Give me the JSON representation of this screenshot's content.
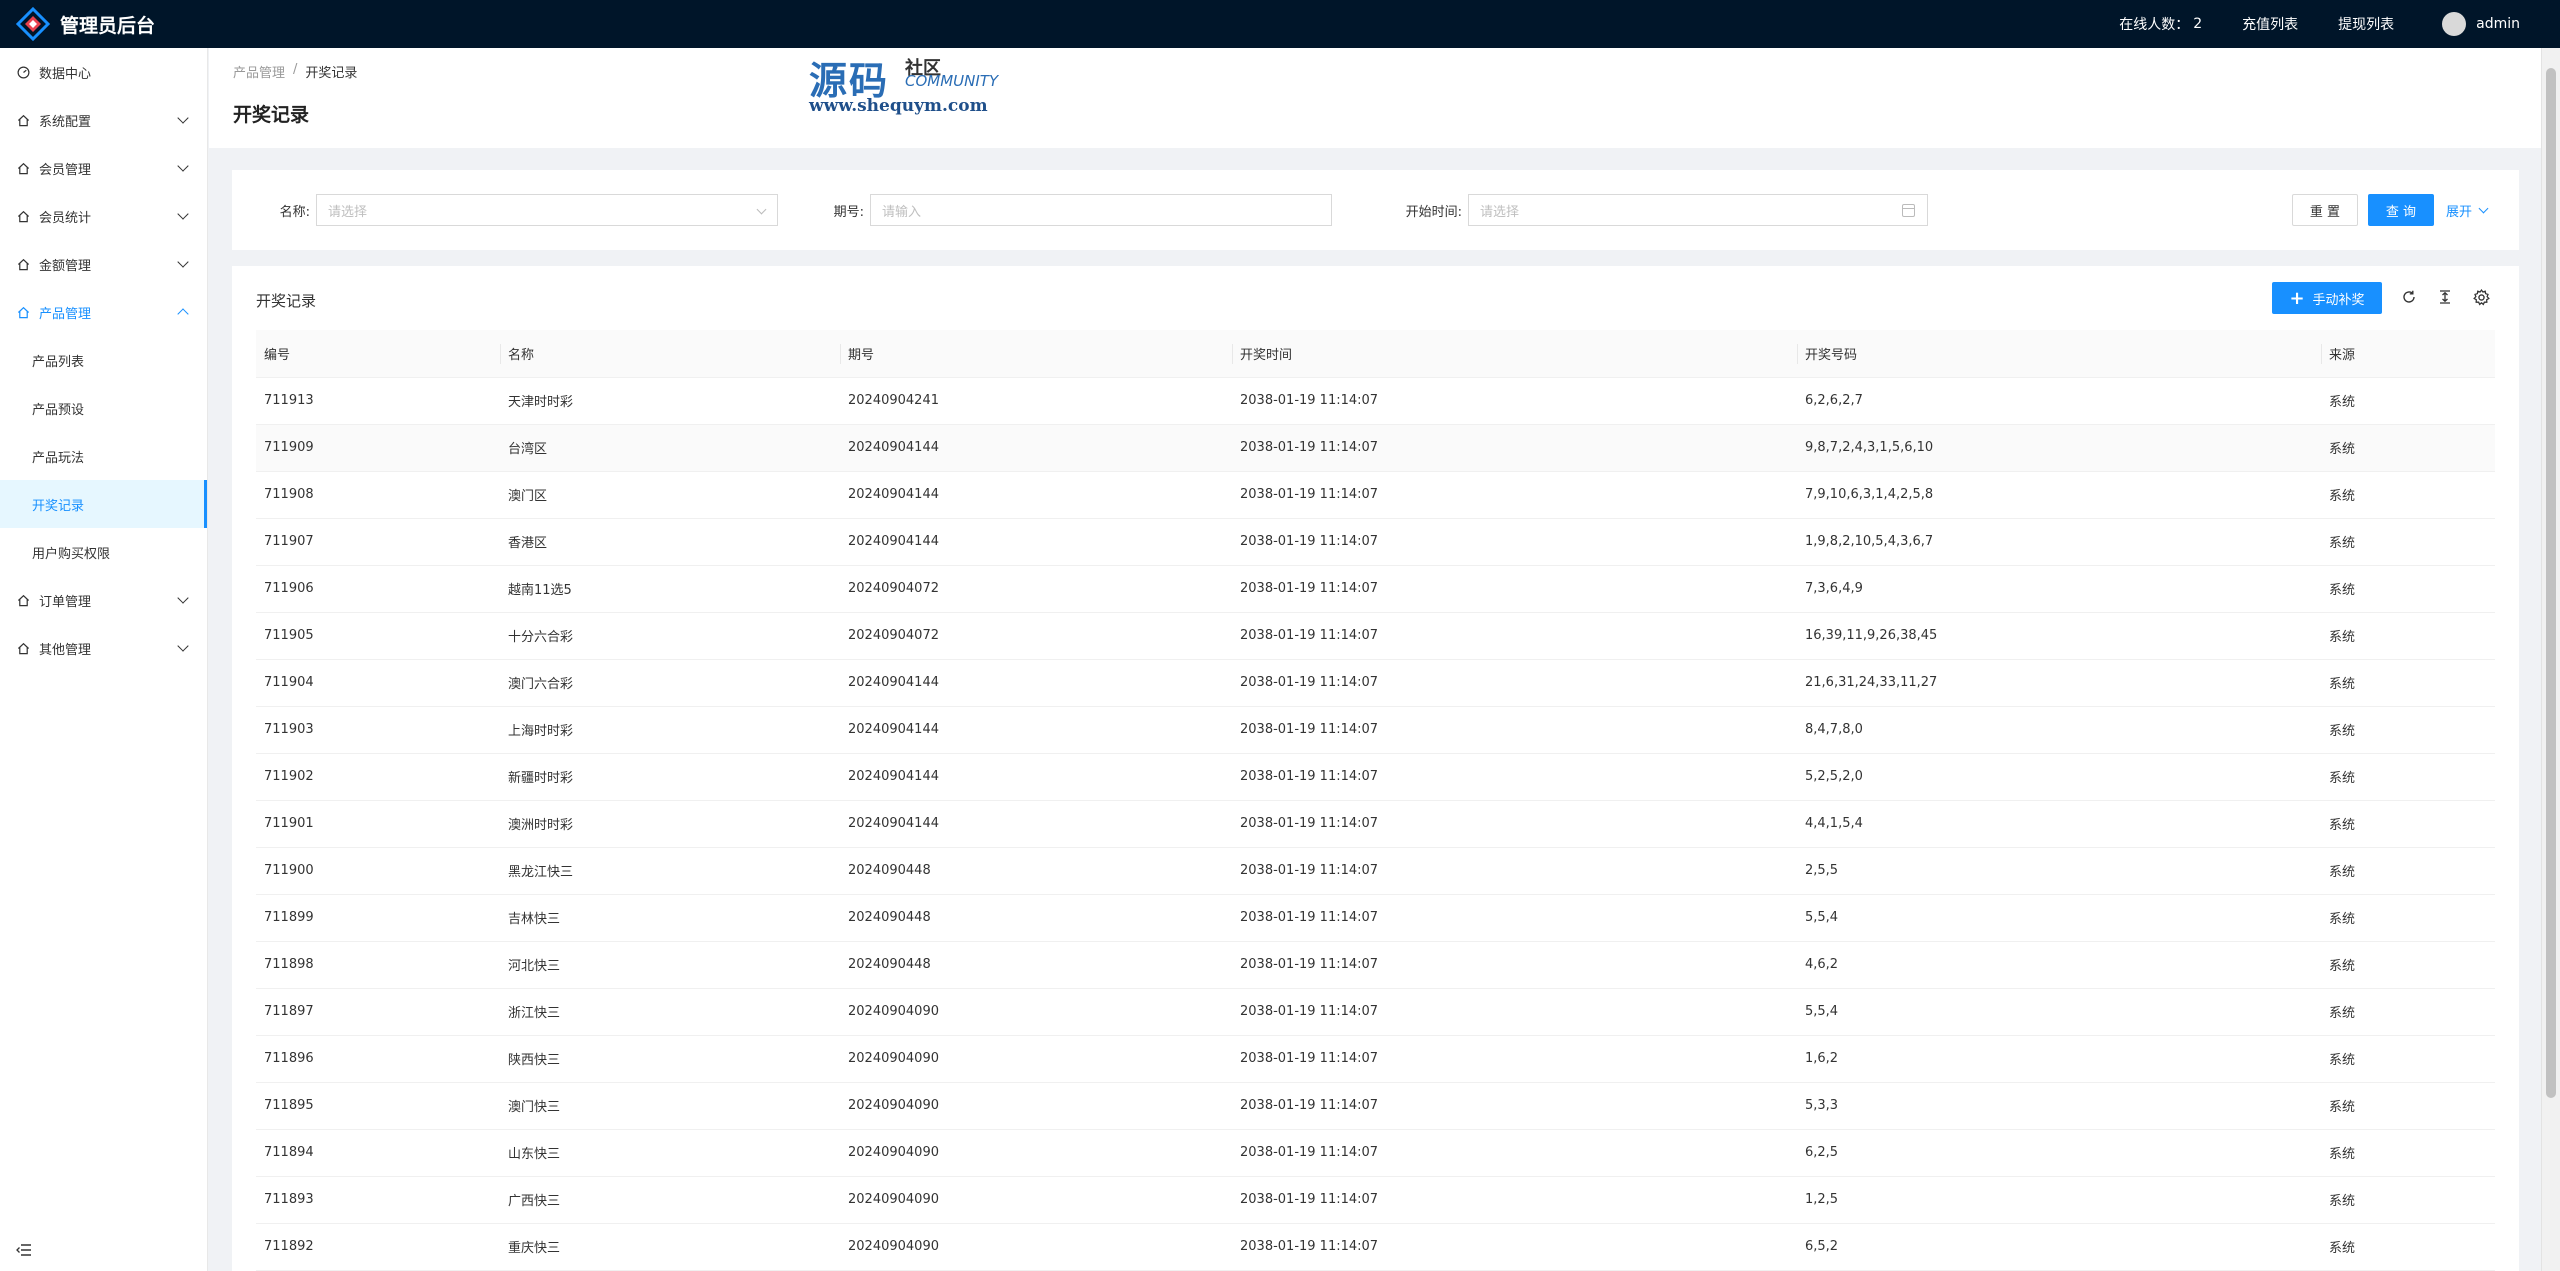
{
  "header": {
    "app_title": "管理员后台",
    "online_label": "在线人数：",
    "online_count": "2",
    "recharge_link": "充值列表",
    "withdraw_link": "提现列表",
    "username": "admin"
  },
  "sidebar": {
    "items": [
      {
        "label": "数据中心",
        "expandable": false
      },
      {
        "label": "系统配置",
        "expandable": true
      },
      {
        "label": "会员管理",
        "expandable": true
      },
      {
        "label": "会员统计",
        "expandable": true
      },
      {
        "label": "金额管理",
        "expandable": true
      },
      {
        "label": "产品管理",
        "expandable": true,
        "open": true
      },
      {
        "label": "订单管理",
        "expandable": true
      },
      {
        "label": "其他管理",
        "expandable": true
      }
    ],
    "submenu": [
      "产品列表",
      "产品预设",
      "产品玩法",
      "开奖记录",
      "用户购买权限"
    ],
    "active_submenu": "开奖记录"
  },
  "page": {
    "breadcrumb_parent": "产品管理",
    "breadcrumb_sep": "/",
    "breadcrumb_current": "开奖记录",
    "title": "开奖记录"
  },
  "watermark": {
    "big": "源码",
    "small1": "社区",
    "small2": "COMMUNITY",
    "url": "www.shequym.com"
  },
  "search": {
    "name_label": "名称:",
    "name_placeholder": "请选择",
    "period_label": "期号:",
    "period_placeholder": "请输入",
    "start_label": "开始时间:",
    "start_placeholder": "请选择",
    "reset_label": "重 置",
    "query_label": "查 询",
    "expand_label": "展开"
  },
  "table": {
    "title": "开奖记录",
    "add_label": "手动补奖",
    "columns": [
      "编号",
      "名称",
      "期号",
      "开奖时间",
      "开奖号码",
      "来源"
    ],
    "rows": [
      [
        "711913",
        "天津时时彩",
        "20240904241",
        "2038-01-19 11:14:07",
        "6,2,6,2,7",
        "系统"
      ],
      [
        "711909",
        "台湾区",
        "20240904144",
        "2038-01-19 11:14:07",
        "9,8,7,2,4,3,1,5,6,10",
        "系统"
      ],
      [
        "711908",
        "澳门区",
        "20240904144",
        "2038-01-19 11:14:07",
        "7,9,10,6,3,1,4,2,5,8",
        "系统"
      ],
      [
        "711907",
        "香港区",
        "20240904144",
        "2038-01-19 11:14:07",
        "1,9,8,2,10,5,4,3,6,7",
        "系统"
      ],
      [
        "711906",
        "越南11选5",
        "20240904072",
        "2038-01-19 11:14:07",
        "7,3,6,4,9",
        "系统"
      ],
      [
        "711905",
        "十分六合彩",
        "20240904072",
        "2038-01-19 11:14:07",
        "16,39,11,9,26,38,45",
        "系统"
      ],
      [
        "711904",
        "澳门六合彩",
        "20240904144",
        "2038-01-19 11:14:07",
        "21,6,31,24,33,11,27",
        "系统"
      ],
      [
        "711903",
        "上海时时彩",
        "20240904144",
        "2038-01-19 11:14:07",
        "8,4,7,8,0",
        "系统"
      ],
      [
        "711902",
        "新疆时时彩",
        "20240904144",
        "2038-01-19 11:14:07",
        "5,2,5,2,0",
        "系统"
      ],
      [
        "711901",
        "澳洲时时彩",
        "20240904144",
        "2038-01-19 11:14:07",
        "4,4,1,5,4",
        "系统"
      ],
      [
        "711900",
        "黑龙江快三",
        "2024090448",
        "2038-01-19 11:14:07",
        "2,5,5",
        "系统"
      ],
      [
        "711899",
        "吉林快三",
        "2024090448",
        "2038-01-19 11:14:07",
        "5,5,4",
        "系统"
      ],
      [
        "711898",
        "河北快三",
        "2024090448",
        "2038-01-19 11:14:07",
        "4,6,2",
        "系统"
      ],
      [
        "711897",
        "浙江快三",
        "20240904090",
        "2038-01-19 11:14:07",
        "5,5,4",
        "系统"
      ],
      [
        "711896",
        "陕西快三",
        "20240904090",
        "2038-01-19 11:14:07",
        "1,6,2",
        "系统"
      ],
      [
        "711895",
        "澳门快三",
        "20240904090",
        "2038-01-19 11:14:07",
        "5,3,3",
        "系统"
      ],
      [
        "711894",
        "山东快三",
        "20240904090",
        "2038-01-19 11:14:07",
        "6,2,5",
        "系统"
      ],
      [
        "711893",
        "广西快三",
        "20240904090",
        "2038-01-19 11:14:07",
        "1,2,5",
        "系统"
      ],
      [
        "711892",
        "重庆快三",
        "20240904090",
        "2038-01-19 11:14:07",
        "6,5,2",
        "系统"
      ]
    ]
  },
  "colors": {
    "primary": "#1890ff",
    "topbar": "#001529"
  }
}
